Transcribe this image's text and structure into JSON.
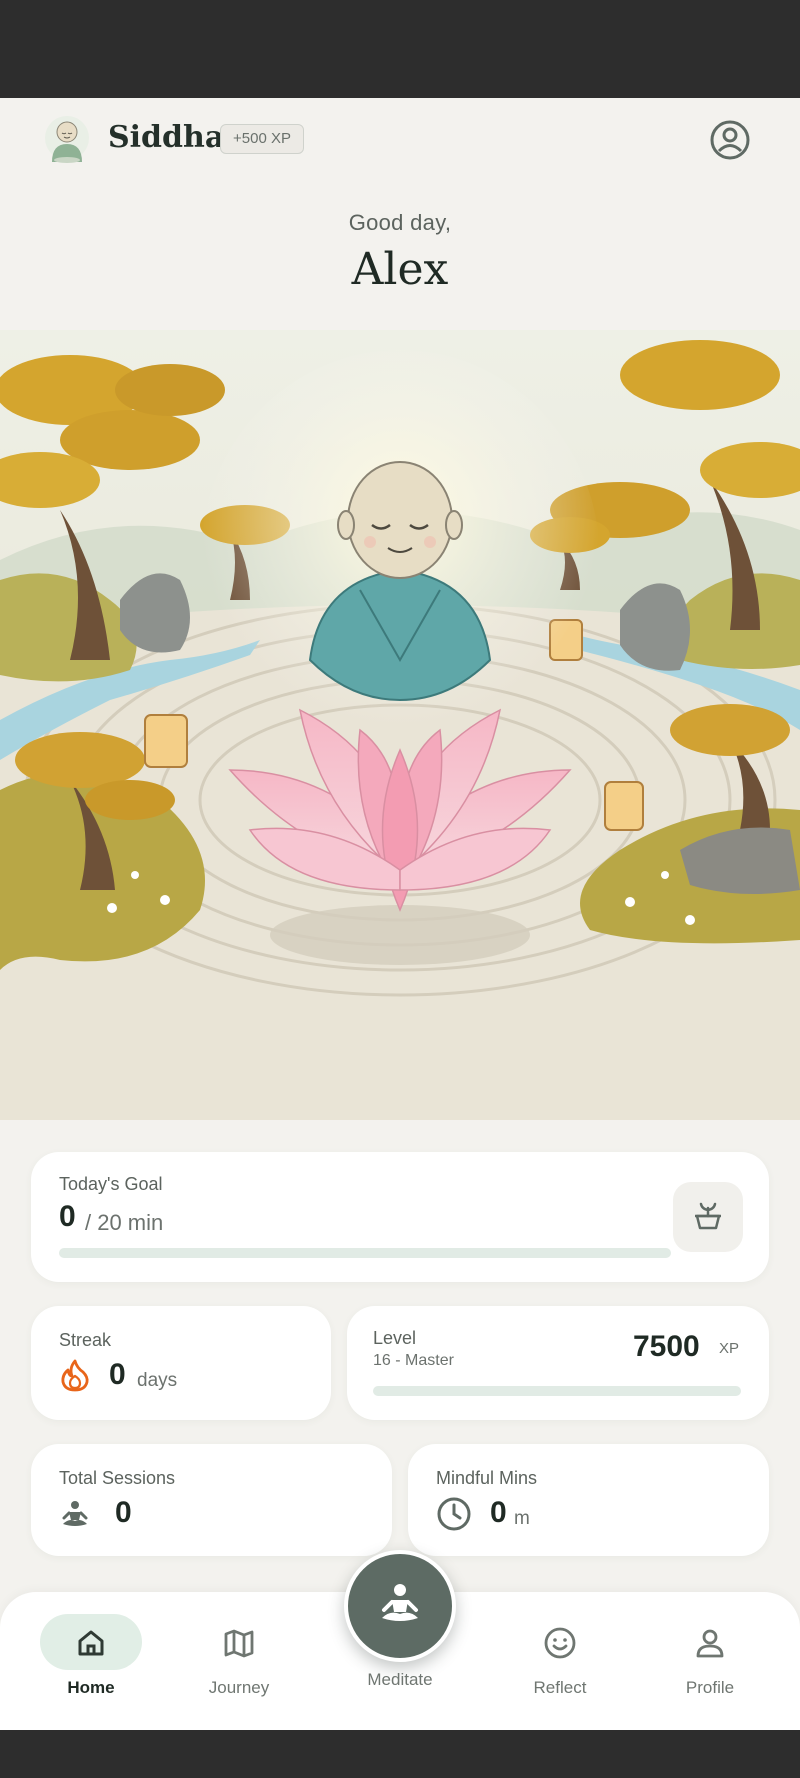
{
  "header": {
    "brand": "Siddha",
    "xp_badge": "+500 XP",
    "avatar_icon": "monk-avatar-icon",
    "profile_icon": "user-circle-icon"
  },
  "greeting": {
    "line": "Good day,",
    "name": "Alex"
  },
  "hero": {
    "description_icon": "meditating-monk-on-lotus-illustration"
  },
  "goal": {
    "label": "Today's Goal",
    "value": "0",
    "target": "/ 20 min",
    "progress": 0,
    "action_icon": "plant-pot-icon"
  },
  "streak": {
    "label": "Streak",
    "value": "0",
    "unit": "days",
    "icon": "flame-icon",
    "icon_color": "#e8651a"
  },
  "level": {
    "label": "Level",
    "sub": "16 - Master",
    "value": "7500",
    "unit": "XP",
    "progress": 0
  },
  "sessions": {
    "label": "Total Sessions",
    "value": "0",
    "icon": "meditation-pose-icon"
  },
  "mindful": {
    "label": "Mindful Mins",
    "value": "0",
    "unit": "m",
    "icon": "clock-icon"
  },
  "nav": {
    "items": [
      {
        "label": "Home",
        "icon": "home-icon",
        "active": true
      },
      {
        "label": "Journey",
        "icon": "map-icon",
        "active": false
      },
      {
        "label": "Meditate",
        "icon": "meditation-pose-icon",
        "active": false
      },
      {
        "label": "Reflect",
        "icon": "smile-icon",
        "active": false
      },
      {
        "label": "Profile",
        "icon": "user-icon",
        "active": false
      }
    ]
  },
  "colors": {
    "accent": "#5d6b64",
    "background": "#f3f2ee",
    "active_pill": "#e1eee6"
  }
}
